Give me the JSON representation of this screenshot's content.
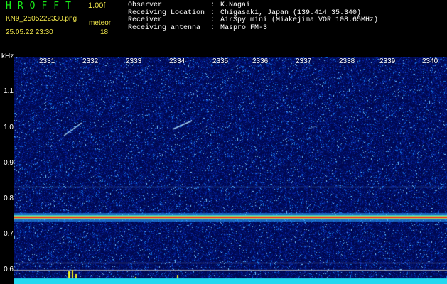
{
  "header": {
    "app_title": "HROFFT",
    "version": "1.00f",
    "filename": "KN9_2505222330.png",
    "mode": "meteor",
    "datetime": "25.05.22 23:30",
    "count": "18"
  },
  "info": [
    {
      "label": "Observer",
      "value": "K.Nagai"
    },
    {
      "label": "Receiving Location",
      "value": "Chigasaki, Japan (139.414 35.340)"
    },
    {
      "label": "Receiver",
      "value": "AirSpy mini (Miakejima VOR 108.65MHz)"
    },
    {
      "label": "Receiving antenna",
      "value": "Maspro FM-3"
    }
  ],
  "axis": {
    "y_unit": "kHz",
    "y_ticks": [
      "1.1",
      "1.0",
      "0.9",
      "0.8",
      "0.7",
      "0.6"
    ],
    "x_ticks": [
      "2331",
      "2332",
      "2333",
      "2334",
      "2335",
      "2336",
      "2337",
      "2338",
      "2339",
      "2340"
    ]
  },
  "colors": {
    "background": "#000a5c",
    "carrier_center": "#ff2020",
    "label_yellow": "#f0e64a",
    "title_green": "#19f019",
    "baseline_cyan": "#22d8f0"
  }
}
